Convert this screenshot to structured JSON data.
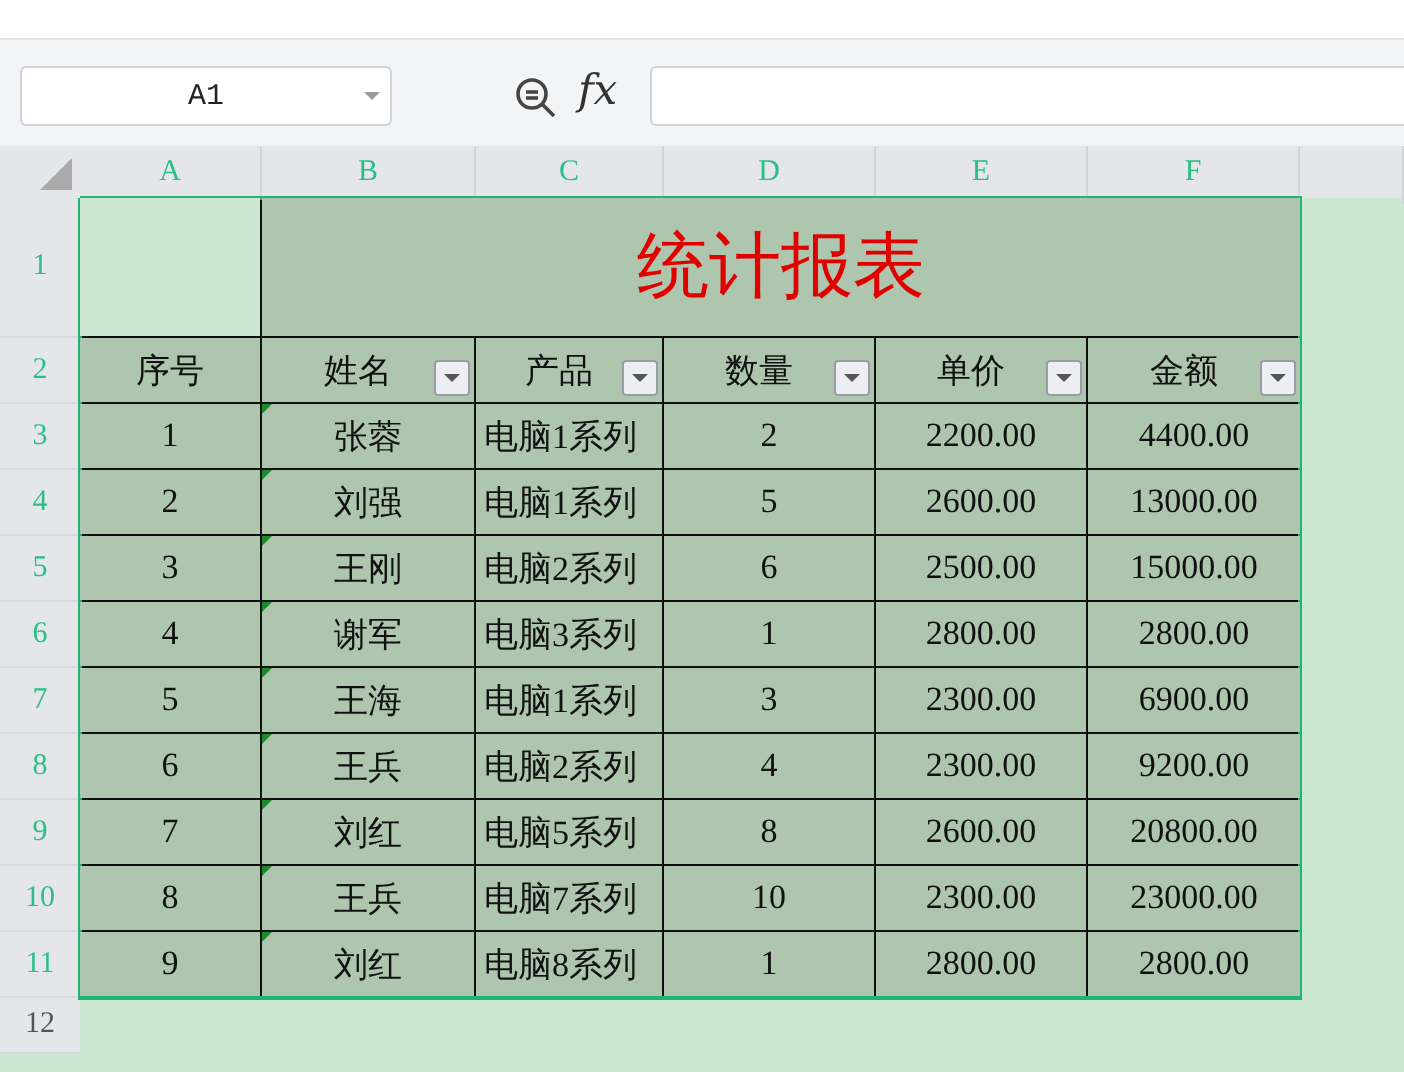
{
  "formula_bar": {
    "name_box": "A1",
    "function_label": "fx"
  },
  "columns": [
    {
      "label": "A",
      "selected": true
    },
    {
      "label": "B",
      "selected": true
    },
    {
      "label": "C",
      "selected": true
    },
    {
      "label": "D",
      "selected": true
    },
    {
      "label": "E",
      "selected": true
    },
    {
      "label": "F",
      "selected": true
    }
  ],
  "row_numbers": [
    {
      "label": "1",
      "selected": true
    },
    {
      "label": "2",
      "selected": true
    },
    {
      "label": "3",
      "selected": true
    },
    {
      "label": "4",
      "selected": true
    },
    {
      "label": "5",
      "selected": true
    },
    {
      "label": "6",
      "selected": true
    },
    {
      "label": "7",
      "selected": true
    },
    {
      "label": "8",
      "selected": true
    },
    {
      "label": "9",
      "selected": true
    },
    {
      "label": "10",
      "selected": true
    },
    {
      "label": "11",
      "selected": true
    },
    {
      "label": "12",
      "selected": false
    }
  ],
  "table": {
    "title": "统计报表",
    "headers": [
      "序号",
      "姓名",
      "产品",
      "数量",
      "单价",
      "金额"
    ],
    "rows": [
      {
        "cells": [
          "1",
          "张蓉",
          "电脑1系列",
          "2",
          "2200.00",
          "4400.00"
        ],
        "marked": true
      },
      {
        "cells": [
          "2",
          "刘强",
          "电脑1系列",
          "5",
          "2600.00",
          "13000.00"
        ],
        "marked": true
      },
      {
        "cells": [
          "3",
          "王刚",
          "电脑2系列",
          "6",
          "2500.00",
          "15000.00"
        ],
        "marked": true
      },
      {
        "cells": [
          "4",
          "谢军",
          "电脑3系列",
          "1",
          "2800.00",
          "2800.00"
        ],
        "marked": true
      },
      {
        "cells": [
          "5",
          "王海",
          "电脑1系列",
          "3",
          "2300.00",
          "6900.00"
        ],
        "marked": true
      },
      {
        "cells": [
          "6",
          "王兵",
          "电脑2系列",
          "4",
          "2300.00",
          "9200.00"
        ],
        "marked": true
      },
      {
        "cells": [
          "7",
          "刘红",
          "电脑5系列",
          "8",
          "2600.00",
          "20800.00"
        ],
        "marked": true
      },
      {
        "cells": [
          "8",
          "王兵",
          "电脑7系列",
          "10",
          "2300.00",
          "23000.00"
        ],
        "marked": true
      },
      {
        "cells": [
          "9",
          "刘红",
          "电脑8系列",
          "1",
          "2800.00",
          "2800.00"
        ],
        "marked": true
      }
    ]
  }
}
